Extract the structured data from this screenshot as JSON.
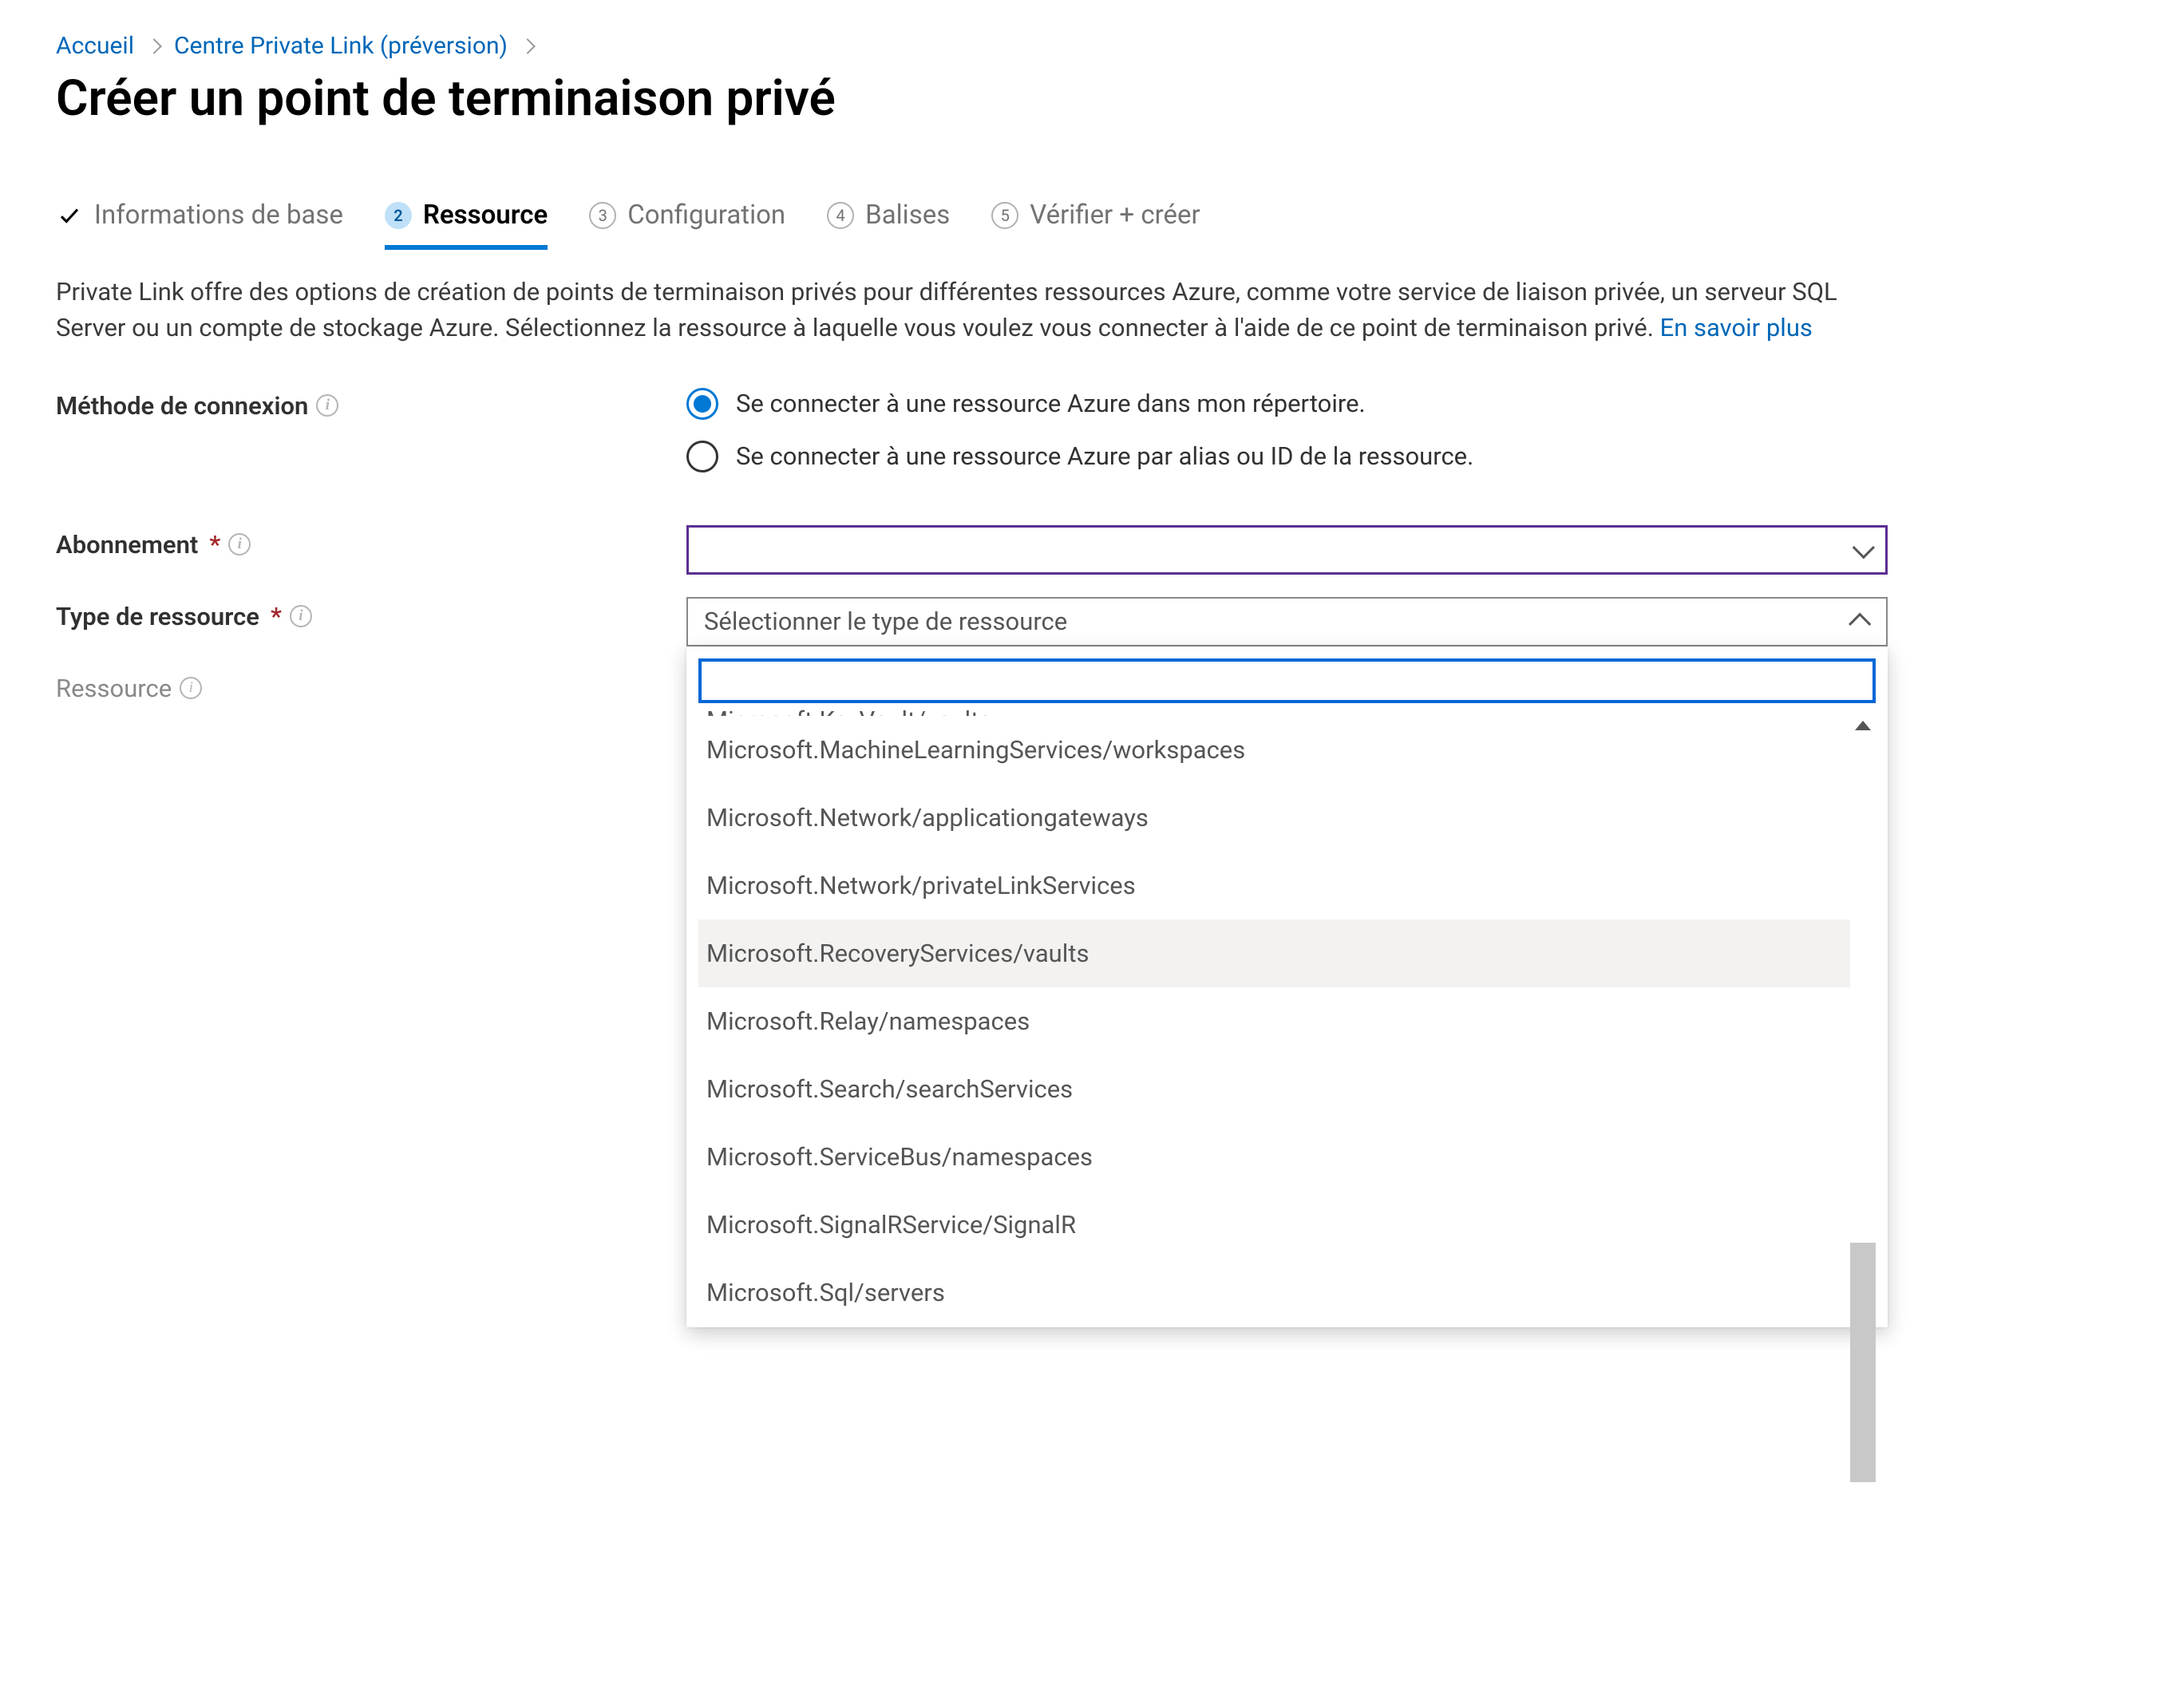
{
  "breadcrumb": {
    "home": "Accueil",
    "center": "Centre Private Link (préversion)"
  },
  "page_title": "Créer un point de terminaison privé",
  "tabs": {
    "t1": "Informations de base",
    "t2": "Ressource",
    "t3": "Configuration",
    "t4": "Balises",
    "t5": "Vérifier + créer",
    "badge2": "2",
    "badge3": "3",
    "badge4": "4",
    "badge5": "5"
  },
  "description": {
    "text": "Private Link offre des options de création de points de terminaison privés pour différentes ressources Azure, comme votre service de liaison privée, un serveur SQL Server ou un compte de stockage Azure. Sélectionnez la ressource à laquelle vous voulez vous connecter à l'aide de ce point de terminaison privé.",
    "learn_more": "En savoir plus"
  },
  "form": {
    "connection_method_label": "Méthode de connexion",
    "radio_option1": "Se connecter à une ressource Azure dans mon répertoire.",
    "radio_option2": "Se connecter à une ressource Azure par alias ou ID de la ressource.",
    "subscription_label": "Abonnement",
    "resource_type_label": "Type de ressource",
    "resource_type_placeholder": "Sélectionner le type de ressource",
    "resource_label": "Ressource"
  },
  "resource_type_options": {
    "clipped": "Microsoft.KeyVault/vaults",
    "items": [
      "Microsoft.MachineLearningServices/workspaces",
      "Microsoft.Network/applicationgateways",
      "Microsoft.Network/privateLinkServices",
      "Microsoft.RecoveryServices/vaults",
      "Microsoft.Relay/namespaces",
      "Microsoft.Search/searchServices",
      "Microsoft.ServiceBus/namespaces",
      "Microsoft.SignalRService/SignalR",
      "Microsoft.Sql/servers"
    ],
    "hover_index": 3
  }
}
